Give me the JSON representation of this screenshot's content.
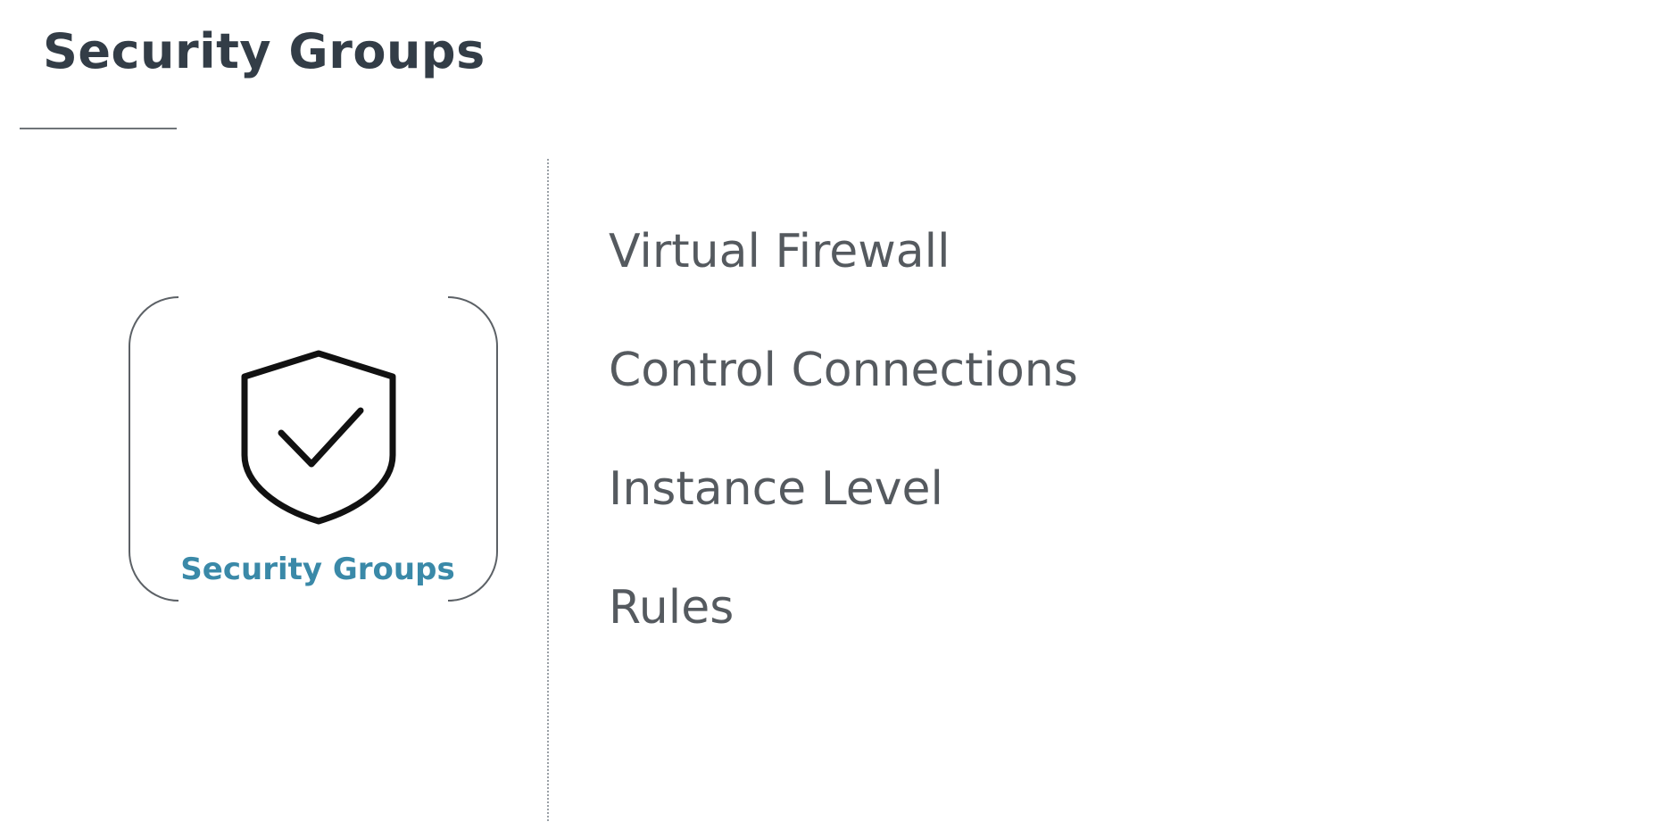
{
  "title": "Security Groups",
  "card": {
    "icon": "shield-check-icon",
    "label": "Security Groups",
    "label_color": "#3a89a8"
  },
  "items": [
    {
      "label": "Virtual Firewall"
    },
    {
      "label": "Control Connections"
    },
    {
      "label": "Instance Level"
    },
    {
      "label": "Rules"
    }
  ],
  "colors": {
    "title": "#333d47",
    "body_text": "#555a5f"
  }
}
